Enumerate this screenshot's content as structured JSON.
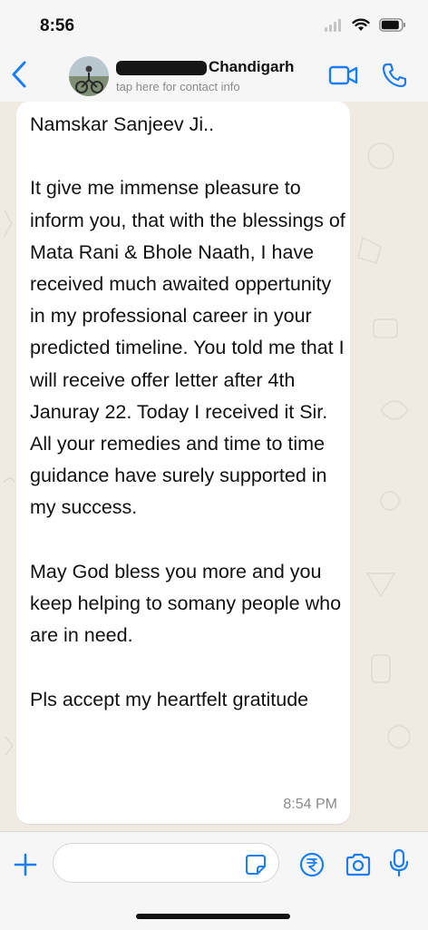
{
  "status_bar": {
    "time": "8:56"
  },
  "header": {
    "contact_name_suffix": "Chandigarh",
    "subtitle": "tap here for contact info"
  },
  "message": {
    "text": "Namskar Sanjeev Ji..\n\nIt give me immense pleasure to inform you, that with the blessings of Mata Rani & Bhole Naath, I have received much awaited oppertunity in my professional career in your predicted timeline. You told me that I will receive offer letter after 4th Januray 22. Today I received it Sir. All your remedies and time to time guidance have surely supported in my success.\n\nMay God bless you more and you keep helping to somany people who are in need.\n\nPls accept my heartfelt gratitude",
    "time": "8:54 PM"
  },
  "input": {
    "value": ""
  },
  "colors": {
    "accent": "#1a7ef2",
    "chat_bg": "#efeae2",
    "bubble": "#ffffff"
  },
  "icons": [
    "back-chevron-icon",
    "video-call-icon",
    "phone-icon",
    "plus-icon",
    "sticker-icon",
    "rupee-payment-icon",
    "camera-icon",
    "microphone-icon"
  ]
}
